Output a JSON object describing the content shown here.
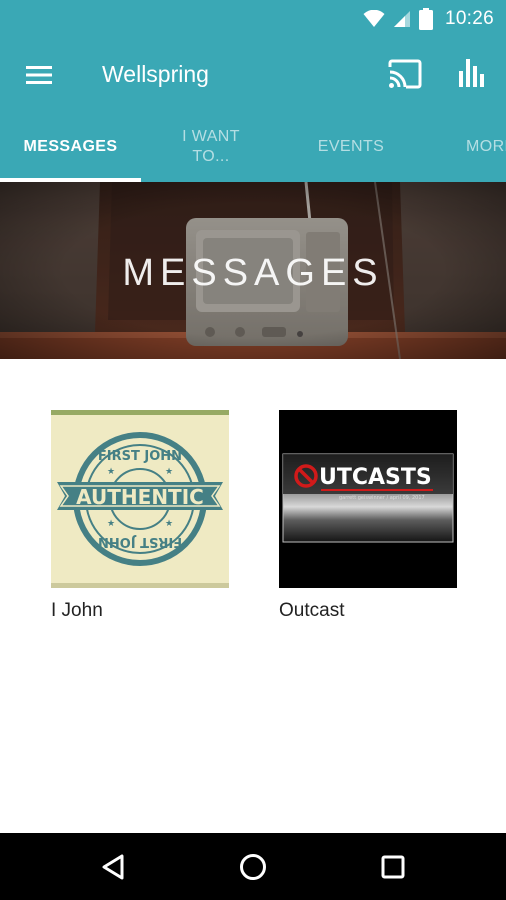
{
  "status_bar": {
    "time": "10:26",
    "icons": [
      "wifi-icon",
      "signal-icon",
      "battery-icon"
    ]
  },
  "app_bar": {
    "title": "Wellspring",
    "menu_icon": "menu-icon",
    "cast_icon": "cast-icon",
    "stats_icon": "bar-chart-icon"
  },
  "tabs": [
    {
      "label": "MESSAGES",
      "active": true
    },
    {
      "label": "I WANT TO...",
      "active": false
    },
    {
      "label": "EVENTS",
      "active": false
    },
    {
      "label": "MORE",
      "active": false
    }
  ],
  "hero": {
    "title": "MESSAGES"
  },
  "series": [
    {
      "title": "I John",
      "artwork": {
        "top_text": "FIRST JOHN",
        "banner_text": "AUTHENTIC",
        "bottom_text": "FIRST JOHN"
      }
    },
    {
      "title": "Outcast",
      "artwork": {
        "headline": "UTCASTS",
        "subtitle": "garrett geiswinner  /  april 09, 2017"
      }
    }
  ],
  "nav_bar": {
    "icons": [
      "back-icon",
      "home-icon",
      "recents-icon"
    ]
  },
  "colors": {
    "brand": "#3aa8b5",
    "text_primary": "#222222",
    "nav_background": "#000000"
  }
}
